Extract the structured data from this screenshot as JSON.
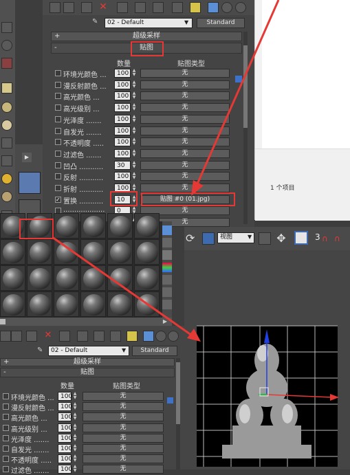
{
  "material_editor_top": {
    "material_name": "02 - Default",
    "material_type": "Standard",
    "supersampling_label": "超级采样",
    "maps_label": "贴图",
    "col_amount": "数量",
    "col_map_type": "贴图类型",
    "maps": [
      {
        "label": "环境光颜色 ...",
        "amount": "100",
        "map": "无"
      },
      {
        "label": "漫反射颜色 ...",
        "amount": "100",
        "map": "无"
      },
      {
        "label": "高光颜色 ...",
        "amount": "100",
        "map": "无"
      },
      {
        "label": "高光级别 ...",
        "amount": "100",
        "map": "无"
      },
      {
        "label": "光泽度 .......",
        "amount": "100",
        "map": "无"
      },
      {
        "label": "自发光 .......",
        "amount": "100",
        "map": "无"
      },
      {
        "label": "不透明度 .....",
        "amount": "100",
        "map": "无"
      },
      {
        "label": "过滤色 .......",
        "amount": "100",
        "map": "无"
      },
      {
        "label": "凹凸 ...........",
        "amount": "30",
        "map": "无"
      },
      {
        "label": "反射 ...........",
        "amount": "100",
        "map": "无"
      },
      {
        "label": "折射 ...........",
        "amount": "100",
        "map": "无"
      },
      {
        "label": "置换 ...........",
        "amount": "10",
        "map": "贴图 #0 (01.jpg)"
      },
      {
        "label": "...................",
        "amount": "0",
        "map": "无"
      },
      {
        "label": "...................",
        "amount": "0",
        "map": "无"
      }
    ]
  },
  "explorer": {
    "item_count": "1 个项目"
  },
  "viewport": {
    "view_label": "视图",
    "snap_number": "3"
  },
  "material_editor_bottom": {
    "material_name": "02 - Default",
    "material_type": "Standard",
    "supersampling_label": "超级采样",
    "maps_label": "贴图",
    "col_amount": "数量",
    "col_map_type": "贴图类型",
    "maps": [
      {
        "label": "环境光颜色 ...",
        "amount": "100",
        "map": "无"
      },
      {
        "label": "漫反射颜色 ...",
        "amount": "100",
        "map": "无"
      },
      {
        "label": "高光颜色 ...",
        "amount": "100",
        "map": "无"
      },
      {
        "label": "高光级别 ...",
        "amount": "100",
        "map": "无"
      },
      {
        "label": "光泽度 .......",
        "amount": "100",
        "map": "无"
      },
      {
        "label": "自发光 .......",
        "amount": "100",
        "map": "无"
      },
      {
        "label": "不透明度 .....",
        "amount": "100",
        "map": "无"
      },
      {
        "label": "过滤色 .......",
        "amount": "100",
        "map": "无"
      }
    ]
  },
  "colors": {
    "highlight_red": "#e53935",
    "button_blue": "#5b8fd6"
  }
}
